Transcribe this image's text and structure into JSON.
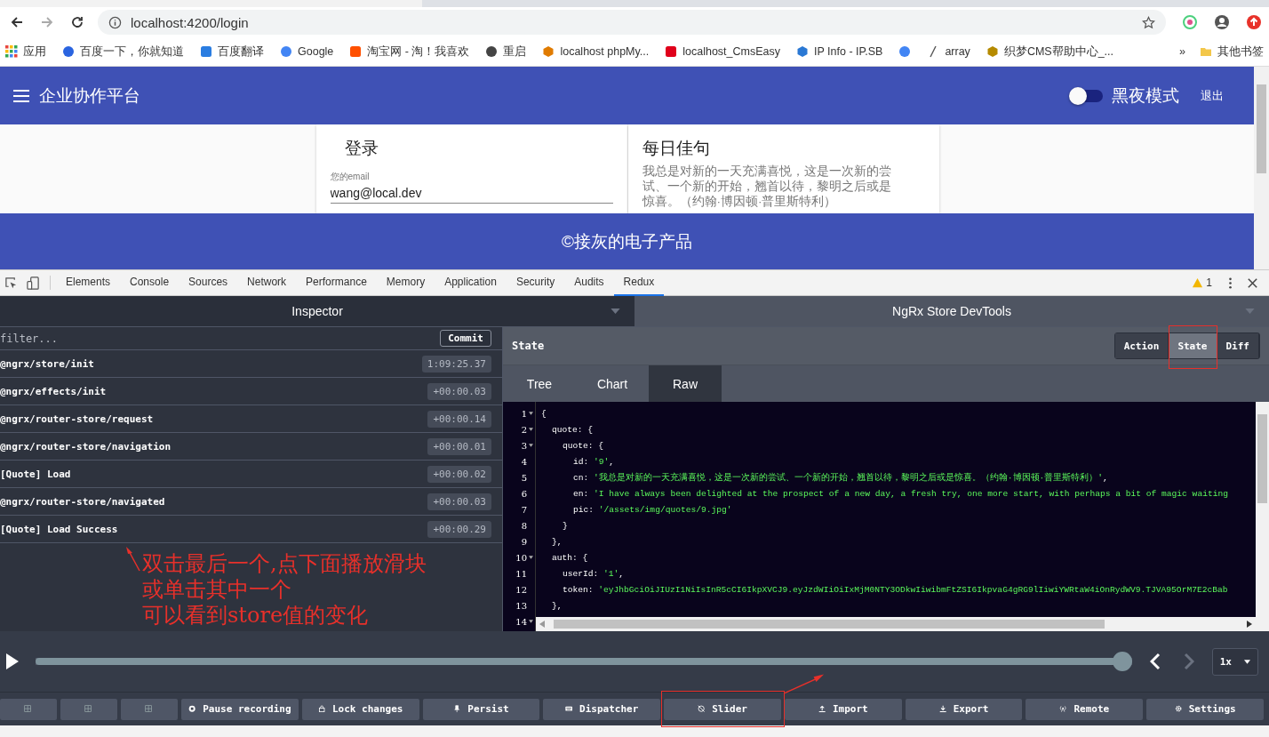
{
  "browser": {
    "url": "localhost:4200/login",
    "bookmarks": [
      {
        "kind": "link",
        "label": "应用"
      },
      {
        "kind": "link",
        "label": "百度一下，你就知道"
      },
      {
        "kind": "link",
        "label": "百度翻译"
      },
      {
        "kind": "link",
        "label": "Google"
      },
      {
        "kind": "link",
        "label": "淘宝网 - 淘！我喜欢"
      },
      {
        "kind": "link",
        "label": "重启"
      },
      {
        "kind": "link",
        "label": "localhost phpMy..."
      },
      {
        "kind": "link",
        "label": "localhost_CmsEasy"
      },
      {
        "kind": "link",
        "label": "IP Info - IP.SB"
      },
      {
        "kind": "icon"
      },
      {
        "kind": "link",
        "label": "array"
      },
      {
        "kind": "link",
        "label": "织梦CMS帮助中心_..."
      }
    ],
    "more": "»",
    "other_bookmarks": "其他书签"
  },
  "app": {
    "title": "企业协作平台",
    "dark_mode": {
      "label": "黑夜模式",
      "on": false
    },
    "logout": "退出",
    "login_card": {
      "title": "登录",
      "email_label": "您的email",
      "email_value": "wang@local.dev"
    },
    "quote_card": {
      "title": "每日佳句",
      "text": "我总是对新的一天充满喜悦，这是一次新的尝试、一个新的开始，翘首以待，黎明之后或是惊喜。（约翰·博因顿·普里斯特利）"
    },
    "footer": "©接灰的电子产品"
  },
  "devtools": {
    "tabs": [
      {
        "label": "Elements",
        "selected": false
      },
      {
        "label": "Console",
        "selected": false
      },
      {
        "label": "Sources",
        "selected": false
      },
      {
        "label": "Network",
        "selected": false
      },
      {
        "label": "Performance",
        "selected": false
      },
      {
        "label": "Memory",
        "selected": false
      },
      {
        "label": "Application",
        "selected": false
      },
      {
        "label": "Security",
        "selected": false
      },
      {
        "label": "Audits",
        "selected": false
      },
      {
        "label": "Redux",
        "selected": true
      }
    ],
    "warnings": "1"
  },
  "inspector": {
    "title": "Inspector",
    "monitor": "NgRx Store DevTools",
    "filter_placeholder": "filter...",
    "commit": "Commit",
    "actions": [
      {
        "name": "@ngrx/store/init",
        "time": "1:09:25.37"
      },
      {
        "name": "@ngrx/effects/init",
        "time": "+00:00.03"
      },
      {
        "name": "@ngrx/router-store/request",
        "time": "+00:00.14"
      },
      {
        "name": "@ngrx/router-store/navigation",
        "time": "+00:00.01"
      },
      {
        "name": "[Quote] Load",
        "time": "+00:00.02"
      },
      {
        "name": "@ngrx/router-store/navigated",
        "time": "+00:00.03"
      },
      {
        "name": "[Quote] Load Success",
        "time": "+00:00.29"
      }
    ]
  },
  "state_panel": {
    "title": "State",
    "modes": [
      {
        "label": "Action",
        "selected": false,
        "highlighted": false
      },
      {
        "label": "State",
        "selected": true,
        "highlighted": true
      },
      {
        "label": "Diff",
        "selected": false,
        "highlighted": false
      }
    ],
    "views": [
      {
        "label": "Tree",
        "selected": false
      },
      {
        "label": "Chart",
        "selected": false
      },
      {
        "label": "Raw",
        "selected": true
      }
    ],
    "code_lines": [
      {
        "num": "1",
        "fold": true,
        "key": "{"
      },
      {
        "num": "2",
        "fold": true,
        "key": "quote: {"
      },
      {
        "num": "3",
        "fold": true,
        "key": "quote: {"
      },
      {
        "num": "4",
        "fold": false,
        "key": "id: ",
        "value": "'9'",
        "tail": ","
      },
      {
        "num": "5",
        "fold": false,
        "key": "cn: ",
        "value": "'我总是对新的一天充满喜悦，这是一次新的尝试、一个新的开始，翘首以待，黎明之后或是惊喜。（约翰·博因顿·普里斯特利）'",
        "tail": ","
      },
      {
        "num": "6",
        "fold": false,
        "key": "en: ",
        "value": "'I have always been delighted at the prospect of a new day, a fresh try, one more start, with perhaps a bit of magic waiting"
      },
      {
        "num": "7",
        "fold": false,
        "key": "pic: ",
        "value": "'/assets/img/quotes/9.jpg'"
      },
      {
        "num": "8",
        "fold": false,
        "key": "}"
      },
      {
        "num": "9",
        "fold": false,
        "key": "},"
      },
      {
        "num": "10",
        "fold": true,
        "key": "auth: {"
      },
      {
        "num": "11",
        "fold": false,
        "key": "userId: ",
        "value": "'1'",
        "tail": ","
      },
      {
        "num": "12",
        "fold": false,
        "key": "token: ",
        "value": "'eyJhbGciOiJIUzI1NiIsInR5cCI6IkpXVCJ9.eyJzdWIiOiIxMjM0NTY3ODkwIiwibmFtZSI6IkpvaG4gRG9lIiwiYWRtaW4iOnRydWV9.TJVA95OrM7E2cBab"
      },
      {
        "num": "13",
        "fold": false,
        "key": "},"
      },
      {
        "num": "14",
        "fold": true
      }
    ]
  },
  "player": {
    "level": 1,
    "prev_disabled": false,
    "next_disabled": true,
    "speed": "1x"
  },
  "toolbar": [
    {
      "kind": "layout",
      "highlighted": false
    },
    {
      "kind": "layout",
      "highlighted": false
    },
    {
      "kind": "layout",
      "highlighted": false
    },
    {
      "kind": "labeled",
      "label": "Pause recording",
      "highlighted": false
    },
    {
      "kind": "labeled",
      "label": "Lock changes",
      "highlighted": false
    },
    {
      "kind": "labeled",
      "label": "Persist",
      "highlighted": false
    },
    {
      "kind": "labeled",
      "label": "Dispatcher",
      "highlighted": false
    },
    {
      "kind": "labeled",
      "label": "Slider",
      "highlighted": true
    },
    {
      "kind": "labeled",
      "label": "Import",
      "highlighted": false
    },
    {
      "kind": "labeled",
      "label": "Export",
      "highlighted": false
    },
    {
      "kind": "labeled",
      "label": "Remote",
      "highlighted": false
    },
    {
      "kind": "labeled",
      "label": "Settings",
      "highlighted": false
    }
  ],
  "annotation": {
    "lines": [
      "双击最后一个,点下面播放滑块",
      "或单击其中一个",
      "可以看到store值的变化"
    ]
  }
}
